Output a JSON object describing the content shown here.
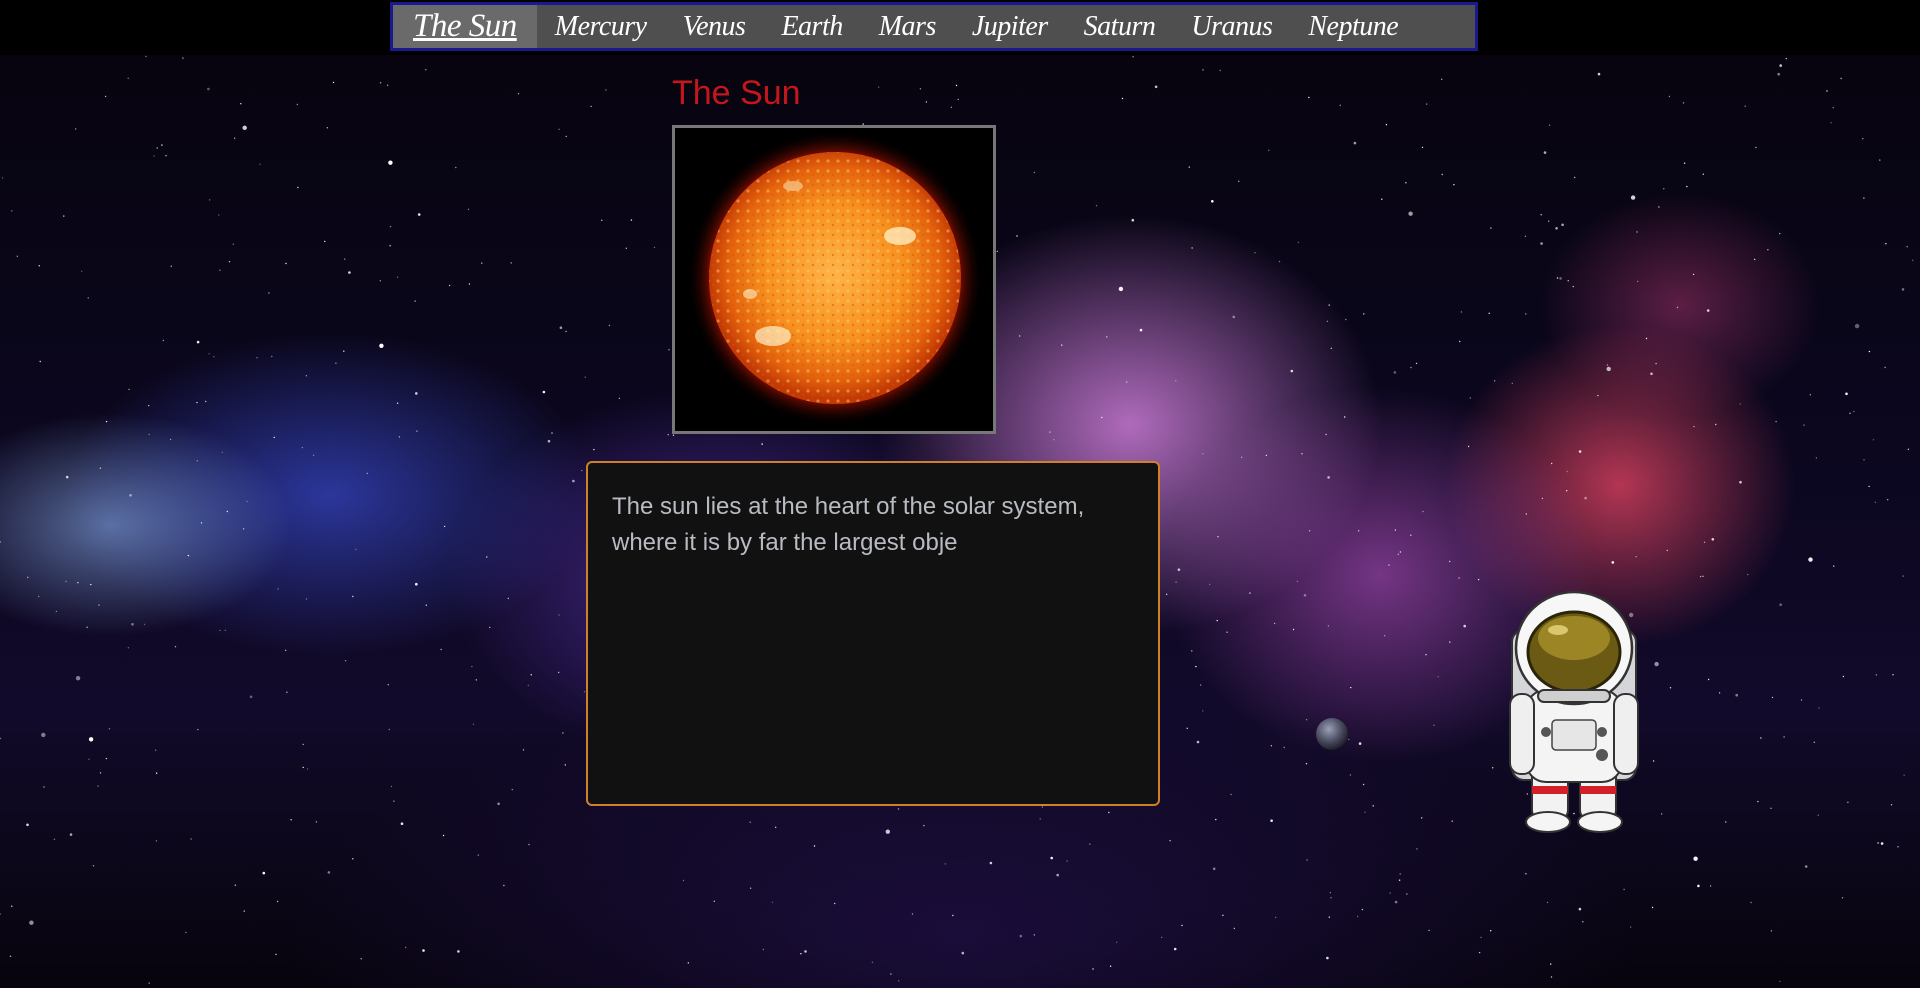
{
  "nav": {
    "items": [
      {
        "label": "The Sun",
        "active": true
      },
      {
        "label": "Mercury",
        "active": false
      },
      {
        "label": "Venus",
        "active": false
      },
      {
        "label": "Earth",
        "active": false
      },
      {
        "label": "Mars",
        "active": false
      },
      {
        "label": "Jupiter",
        "active": false
      },
      {
        "label": "Saturn",
        "active": false
      },
      {
        "label": "Uranus",
        "active": false
      },
      {
        "label": "Neptune",
        "active": false
      }
    ]
  },
  "planet": {
    "title": "The Sun",
    "image_icon": "sun-image",
    "description": "The sun lies at the heart of the solar system, where it is by far the largest obje"
  },
  "decor": {
    "moon_icon": "moon-icon",
    "astronaut_icon": "astronaut-icon"
  },
  "colors": {
    "title": "#c4161c",
    "nav_border": "#1a1a8c",
    "nav_bg": "#4f4f4f",
    "desc_border": "#d0802a",
    "desc_bg": "#111111"
  }
}
